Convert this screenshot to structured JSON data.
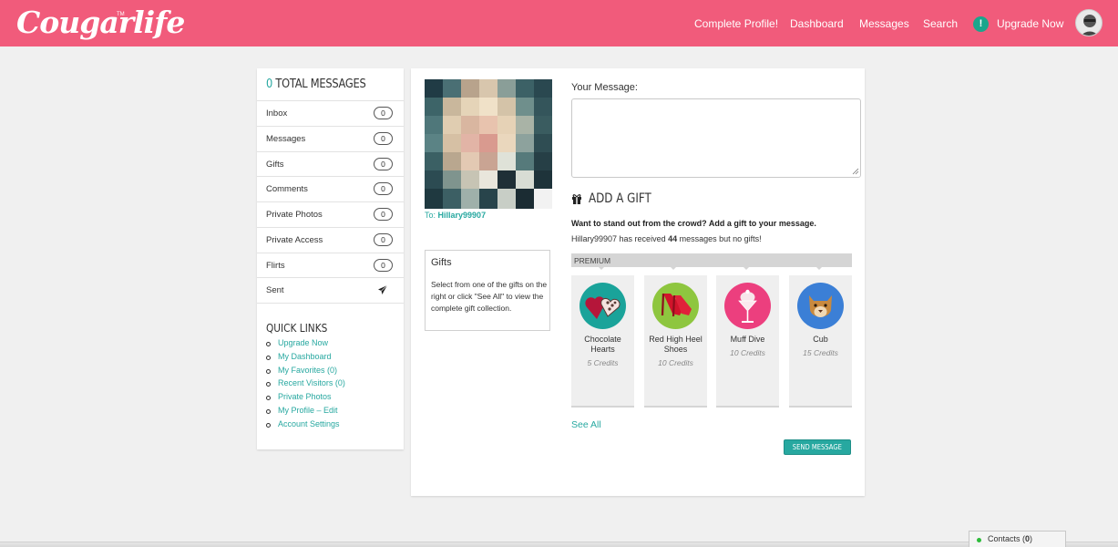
{
  "header": {
    "logo": "Cougarlife",
    "logo_tm": "TM",
    "nav": {
      "complete_profile": "Complete Profile!",
      "dashboard": "Dashboard",
      "messages": "Messages",
      "search": "Search",
      "upgrade_now": "Upgrade Now",
      "upgrade_icon": "!"
    },
    "brand_color": "#f15b7b"
  },
  "sidebar": {
    "total_count": "0",
    "total_label": "TOTAL MESSAGES",
    "items": [
      {
        "label": "Inbox",
        "count": "0"
      },
      {
        "label": "Messages",
        "count": "0"
      },
      {
        "label": "Gifts",
        "count": "0"
      },
      {
        "label": "Comments",
        "count": "0"
      },
      {
        "label": "Private Photos",
        "count": "0"
      },
      {
        "label": "Private Access",
        "count": "0"
      },
      {
        "label": "Flirts",
        "count": "0"
      },
      {
        "label": "Sent",
        "icon": "paper-plane-icon"
      }
    ],
    "quick_links_title": "QUICK LINKS",
    "quick_links": [
      "Upgrade Now",
      "My Dashboard",
      "My Favorites (0)",
      "Recent Visitors (0)",
      "Private Photos",
      "My Profile – Edit",
      "Account Settings"
    ]
  },
  "compose": {
    "to_prefix": "To:",
    "recipient": "Hillary99907",
    "gifts_box_title": "Gifts",
    "gifts_box_text": "Select from one of the gifts on the right or click \"See All\" to view the complete gift collection.",
    "message_label": "Your Message:",
    "message_value": "",
    "add_gift_title": "ADD A GIFT",
    "standout_text": "Want to stand out from the crowd? Add a gift to your message.",
    "received_name": "Hillary99907",
    "received_mid": "has received",
    "received_count": "44",
    "received_tail": "messages but no gifts!",
    "premium_label": "PREMIUM",
    "gifts": [
      {
        "name": "Chocolate Hearts",
        "credits": "5 Credits",
        "icon": "chocolate-hearts-icon",
        "color": "#1aa39a"
      },
      {
        "name": "Red High Heel Shoes",
        "credits": "10 Credits",
        "icon": "red-high-heel-icon",
        "color": "#8ec63f"
      },
      {
        "name": "Muff Dive",
        "credits": "10 Credits",
        "icon": "cocktail-icon",
        "color": "#ec3f7e"
      },
      {
        "name": "Cub",
        "credits": "15 Credits",
        "icon": "cougar-cub-icon",
        "color": "#3b7fd6"
      }
    ],
    "see_all": "See All",
    "send_button": "SEND MESSAGE",
    "accent_color": "#27a8a0"
  },
  "contacts": {
    "label": "Contacts",
    "count": "0"
  }
}
